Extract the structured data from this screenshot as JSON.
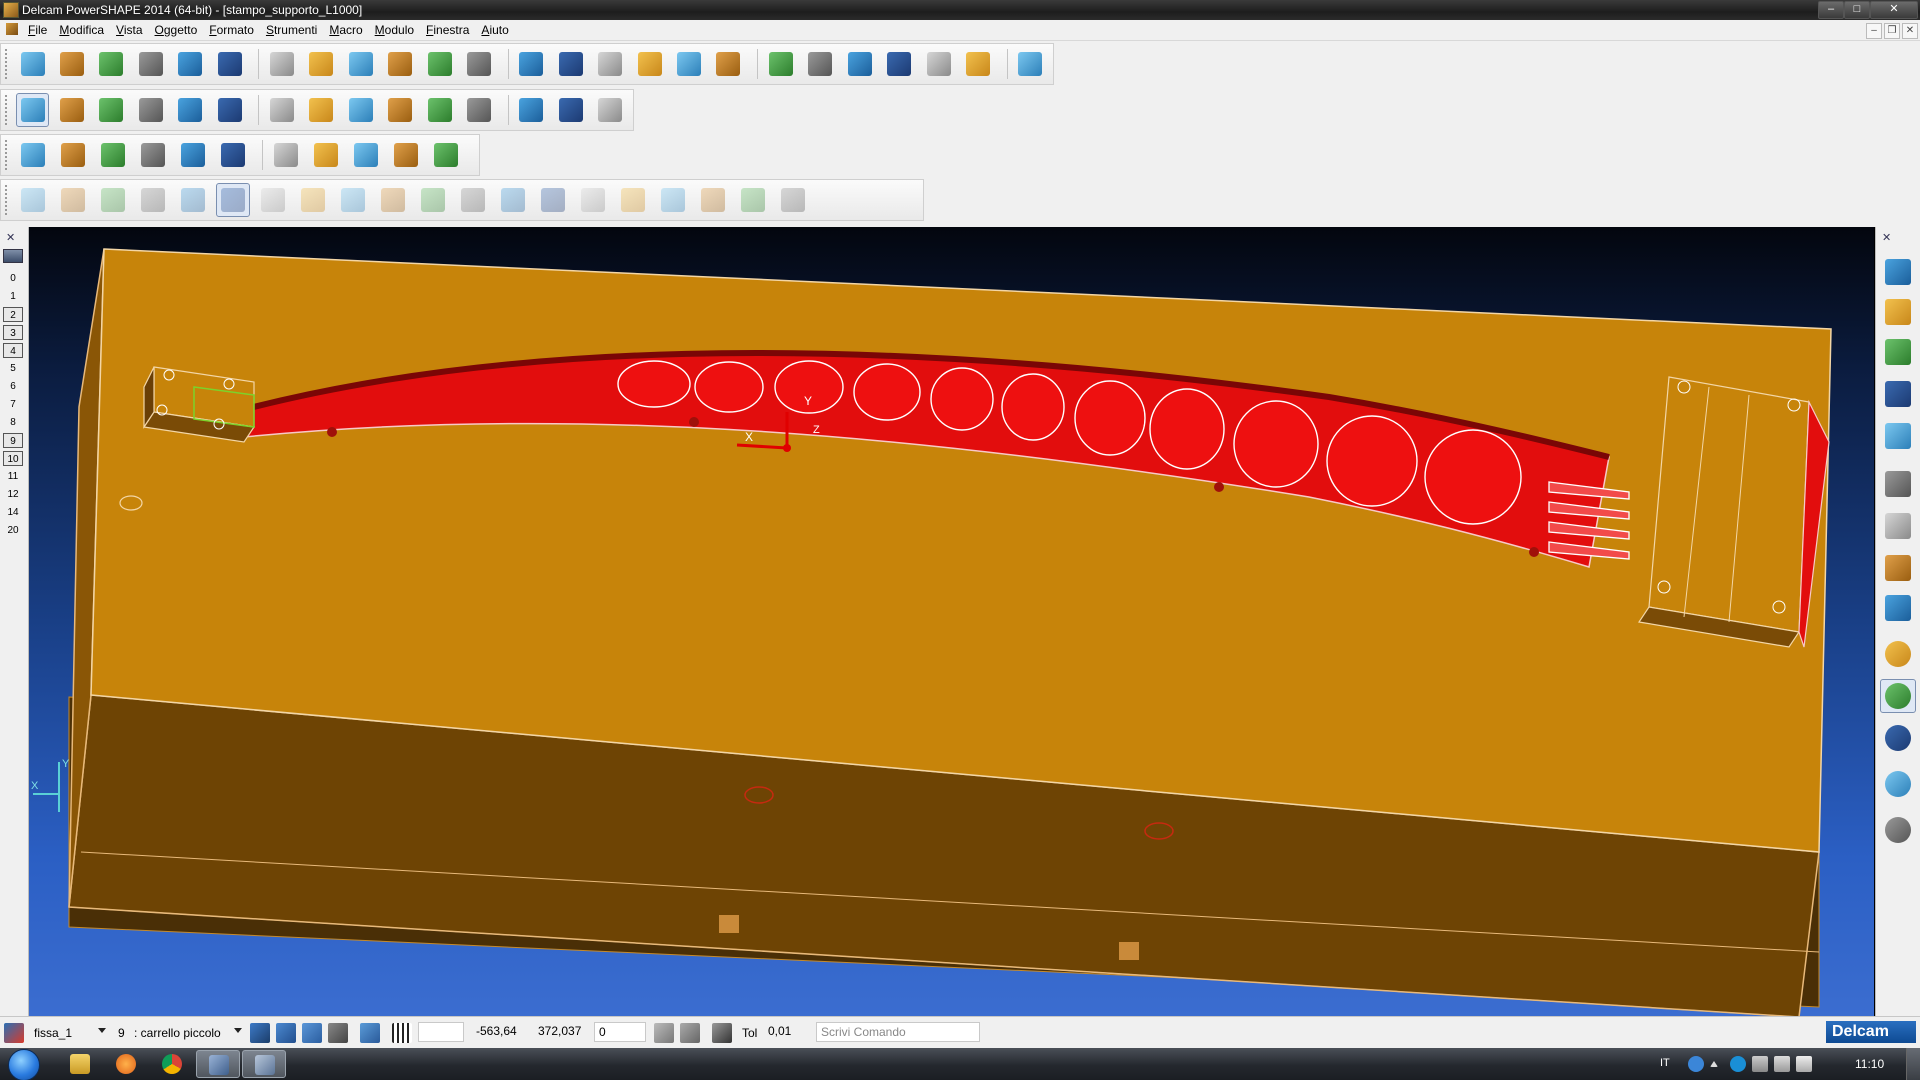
{
  "window": {
    "title": "Delcam PowerSHAPE 2014 (64-bit) - [stampo_supporto_L1000]",
    "minimize_label": "–",
    "maximize_label": "□",
    "close_label": "✕"
  },
  "menu": {
    "items": [
      "File",
      "Modifica",
      "Vista",
      "Oggetto",
      "Formato",
      "Strumenti",
      "Macro",
      "Modulo",
      "Finestra",
      "Aiuto"
    ],
    "mdi_min": "–",
    "mdi_restore": "❐",
    "mdi_close": "✕"
  },
  "toolbars": {
    "row1": [
      "new-model",
      "open",
      "import",
      "save",
      "print",
      "cut",
      "copy",
      "paste",
      "format-painter",
      "delete",
      "undo",
      "redo",
      "edit-sketch",
      "workplane",
      "axis",
      "line",
      "circle",
      "curve",
      "text",
      "surface",
      "solid",
      "wireframe",
      "electrode",
      "mold-tool",
      "wizard"
    ],
    "row2": [
      "select",
      "quick-select",
      "drag",
      "fillet",
      "transform",
      "move",
      "rotate",
      "box",
      "box-multi",
      "cube",
      "array",
      "extrude",
      "sweep",
      "sphere",
      "cone"
    ],
    "row3": [
      "warning",
      "measure",
      "split",
      "align",
      "tools",
      "assembly",
      "blend",
      "hybrid",
      "check",
      "analyze",
      "heal"
    ],
    "row4": [
      "s1",
      "s2",
      "s3",
      "s4",
      "s5",
      "s6",
      "s7",
      "s8",
      "s9",
      "s10",
      "s11",
      "s12",
      "s13",
      "s14",
      "s15",
      "s16",
      "s17",
      "s18",
      "s19",
      "s20"
    ]
  },
  "levels": {
    "close_label": "✕",
    "items": [
      {
        "label": "0",
        "boxed": false
      },
      {
        "label": "1",
        "boxed": false
      },
      {
        "label": "2",
        "boxed": true
      },
      {
        "label": "3",
        "boxed": true
      },
      {
        "label": "4",
        "boxed": true
      },
      {
        "label": "5",
        "boxed": false
      },
      {
        "label": "6",
        "boxed": false
      },
      {
        "label": "7",
        "boxed": false
      },
      {
        "label": "8",
        "boxed": false
      },
      {
        "label": "9",
        "boxed": true
      },
      {
        "label": "10",
        "boxed": true
      },
      {
        "label": "11",
        "boxed": false
      },
      {
        "label": "12",
        "boxed": false
      },
      {
        "label": "14",
        "boxed": false
      },
      {
        "label": "20",
        "boxed": false
      }
    ]
  },
  "viewport": {
    "axis_x": "X",
    "axis_y": "Y",
    "triad_x": "X",
    "triad_y": "Y",
    "triad_z": "Z",
    "colors": {
      "mold": "#c7840a",
      "mold_side": "#6e4404",
      "part": "#e20d0d",
      "background_top": "#03060e",
      "background_bottom": "#3b6dd0"
    }
  },
  "view_toolbar": {
    "close_label": "✕",
    "buttons": [
      "view-iso-1",
      "view-iso-2",
      "view-iso-3",
      "view-iso-4",
      "view-rotate",
      "view-undo",
      "view-zoom",
      "view-zoom-box",
      "view-zoom-fit",
      "view-wireframe",
      "view-shaded",
      "view-diamond",
      "view-material",
      "view-lights"
    ]
  },
  "status": {
    "workplane": "fissa_1",
    "level_number": "9",
    "level_name": ": carrello piccolo",
    "x_coord": "-563,64",
    "y_coord": "372,037",
    "z_coord": "0",
    "tol_label": "Tol",
    "tol_value": "0,01",
    "command_placeholder": "Scrivi Comando",
    "logo": "Delcam"
  },
  "taskbar": {
    "language": "IT",
    "time": "11:10"
  }
}
